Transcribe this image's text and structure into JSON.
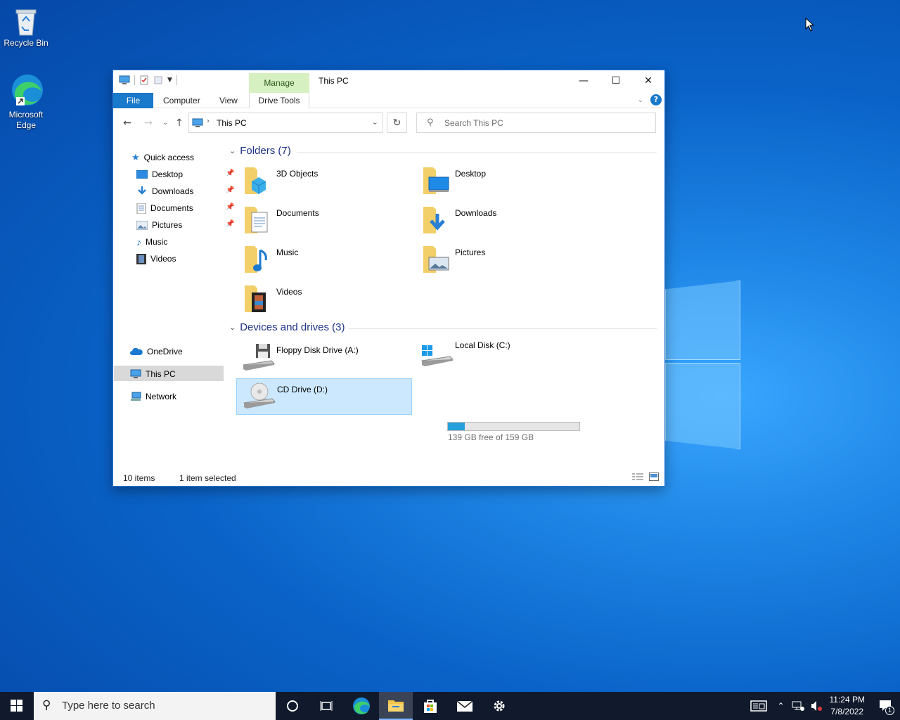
{
  "desktop": {
    "icons": [
      {
        "label": "Recycle Bin",
        "icon": "recycle-bin-icon"
      },
      {
        "label": "Microsoft Edge",
        "icon": "edge-icon"
      }
    ]
  },
  "window": {
    "title": "This PC",
    "contextual_tab_group": "Manage",
    "tabs": {
      "file": "File",
      "computer": "Computer",
      "view": "View",
      "drive_tools": "Drive Tools"
    },
    "address": "This PC",
    "search_placeholder": "Search This PC",
    "nav": [
      {
        "label": "Quick access",
        "icon": "star-icon"
      },
      {
        "label": "Desktop",
        "icon": "desktop-icon",
        "pinned": true
      },
      {
        "label": "Downloads",
        "icon": "download-icon",
        "pinned": true
      },
      {
        "label": "Documents",
        "icon": "document-icon",
        "pinned": true
      },
      {
        "label": "Pictures",
        "icon": "picture-icon",
        "pinned": true
      },
      {
        "label": "Music",
        "icon": "music-icon"
      },
      {
        "label": "Videos",
        "icon": "video-icon"
      },
      {
        "label": "OneDrive",
        "icon": "cloud-icon"
      },
      {
        "label": "This PC",
        "icon": "computer-icon",
        "selected": true
      },
      {
        "label": "Network",
        "icon": "network-icon"
      }
    ],
    "folders_header": "Folders (7)",
    "folders": [
      "3D Objects",
      "Desktop",
      "Documents",
      "Downloads",
      "Music",
      "Pictures",
      "Videos"
    ],
    "devices_header": "Devices and drives (3)",
    "drives": [
      {
        "label": "Floppy Disk Drive (A:)"
      },
      {
        "label": "Local Disk (C:)",
        "free_text": "139 GB free of 159 GB",
        "used_fraction": 0.126
      },
      {
        "label": "CD Drive (D:)",
        "selected": true
      }
    ],
    "status": {
      "items": "10 items",
      "selected": "1 item selected"
    }
  },
  "taskbar": {
    "search_placeholder": "Type here to search",
    "time": "11:24 PM",
    "date": "7/8/2022",
    "notification_count": "1"
  },
  "colors": {
    "accent": "#1979ca",
    "selection": "#cce8ff",
    "manage_tab": "#d6f0c2"
  }
}
